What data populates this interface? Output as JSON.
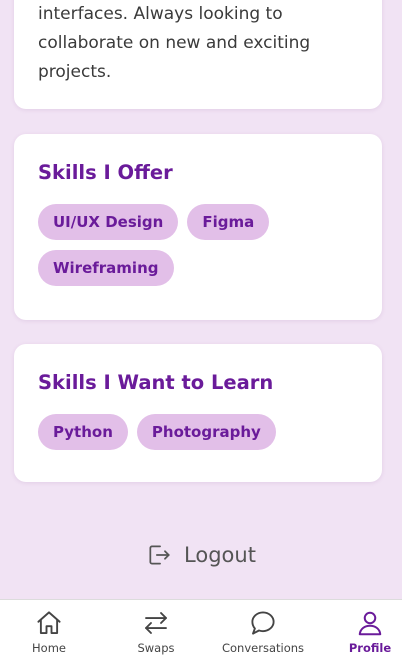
{
  "about": {
    "bio_lines": [
      "interfaces. Always looking to",
      "collaborate on new and exciting",
      "projects."
    ]
  },
  "skills_offer": {
    "title": "Skills I Offer",
    "chips": [
      "UI/UX Design",
      "Figma",
      "Wireframing"
    ]
  },
  "skills_learn": {
    "title": "Skills I Want to Learn",
    "chips": [
      "Python",
      "Photography"
    ]
  },
  "logout": {
    "label": "Logout",
    "icon": "logout-icon"
  },
  "bottom_nav": {
    "items": [
      {
        "label": "Home",
        "icon": "home-icon",
        "active": false
      },
      {
        "label": "Swaps",
        "icon": "swap-icon",
        "active": false
      },
      {
        "label": "Conversations",
        "icon": "chat-bubble-icon",
        "active": false
      },
      {
        "label": "Profile",
        "icon": "user-icon",
        "active": true
      }
    ]
  },
  "colors": {
    "background": "#f1e3f4",
    "accent": "#6a1b9a",
    "chip_bg": "#e2bfe8",
    "card_bg": "#ffffff"
  }
}
